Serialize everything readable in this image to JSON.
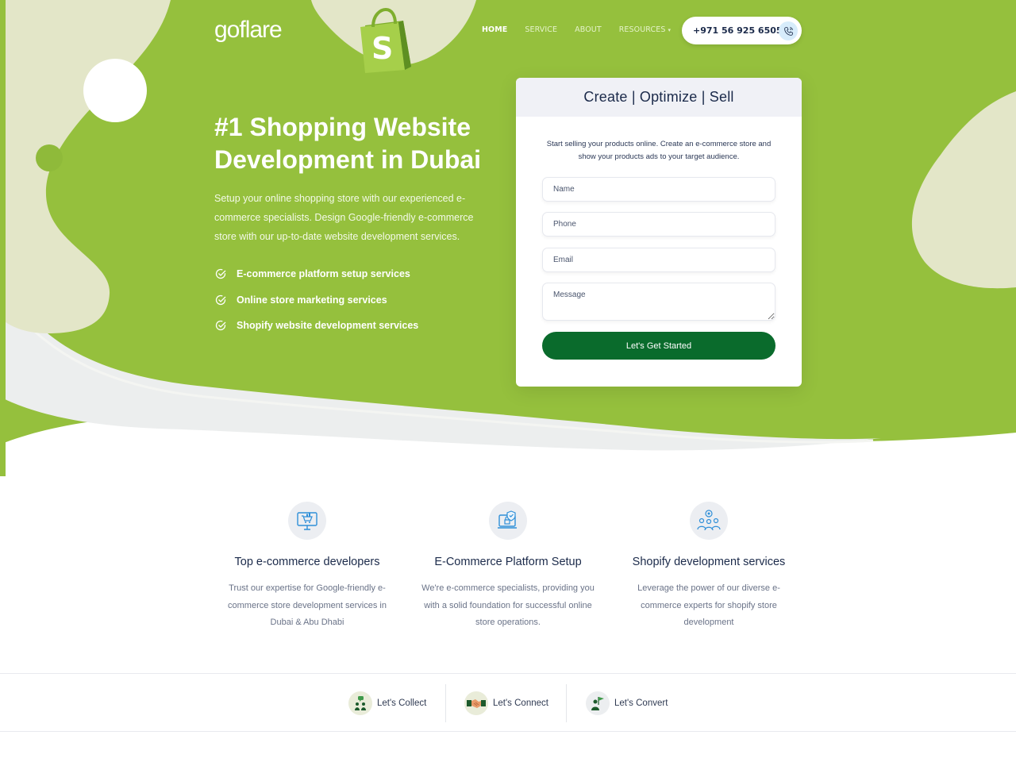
{
  "header": {
    "logo_text": "goflare",
    "nav": [
      {
        "label": "HOME",
        "active": true
      },
      {
        "label": "SERVICE",
        "active": false
      },
      {
        "label": "ABOUT",
        "active": false
      },
      {
        "label": "RESOURCES",
        "active": false
      }
    ],
    "phone": "+971 56 925 6505"
  },
  "hero": {
    "title": "#1 Shopping Website Development in Dubai",
    "description": "Setup your online shopping store with our experienced e-commerce specialists. Design Google-friendly e-commerce store with our up-to-date website development services.",
    "features": [
      "E-commerce platform setup services",
      "Online store marketing services",
      "Shopify website development services"
    ]
  },
  "form": {
    "heading": "Create | Optimize | Sell",
    "intro": "Start selling your products online. Create an e-commerce store and show your products ads to your target audience.",
    "name_placeholder": "Name",
    "phone_placeholder": "Phone",
    "email_placeholder": "Email",
    "message_placeholder": "Message",
    "submit_label": "Let's Get Started"
  },
  "services": [
    {
      "title": "Top e-commerce developers",
      "text": "Trust our expertise for Google-friendly e-commerce store development services in Dubai & Abu Dhabi",
      "icon": "monitor-cart-icon"
    },
    {
      "title": "E-Commerce Platform Setup",
      "text": "We're e-commerce specialists, providing you with a solid foundation for successful online store operations.",
      "icon": "secure-laptop-icon"
    },
    {
      "title": "Shopify development services",
      "text": "Leverage the power of our diverse e-commerce experts for shopify store development",
      "icon": "team-target-icon"
    }
  ],
  "steps": [
    {
      "label": "Let's Collect",
      "icon": "people-chat-icon"
    },
    {
      "label": "Let's Connect",
      "icon": "handshake-icon"
    },
    {
      "label": "Let's Convert",
      "icon": "person-flag-icon"
    }
  ],
  "colors": {
    "brand_green": "#95c03d",
    "light_blob": "#e3e6c8",
    "button_green": "#0a6b2c",
    "heading_navy": "#1b2a4a"
  }
}
